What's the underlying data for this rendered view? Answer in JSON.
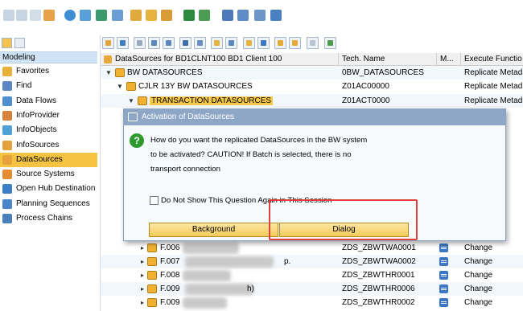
{
  "left_panel": {
    "header": "Modeling",
    "items": [
      {
        "label": "Favorites",
        "icon": "favorites-icon",
        "selected": false
      },
      {
        "label": "Find",
        "icon": "find-icon",
        "selected": false
      },
      {
        "label": "Data Flows",
        "icon": "data-flows-icon",
        "selected": false
      },
      {
        "label": "InfoProvider",
        "icon": "infoprovider-icon",
        "selected": false
      },
      {
        "label": "InfoObjects",
        "icon": "infoobjects-icon",
        "selected": false
      },
      {
        "label": "InfoSources",
        "icon": "infosources-icon",
        "selected": false
      },
      {
        "label": "DataSources",
        "icon": "datasources-icon",
        "selected": true
      },
      {
        "label": "Source Systems",
        "icon": "source-systems-icon",
        "selected": false
      },
      {
        "label": "Open Hub Destination",
        "icon": "open-hub-icon",
        "selected": false
      },
      {
        "label": "Planning Sequences",
        "icon": "planning-sequences-icon",
        "selected": false
      },
      {
        "label": "Process Chains",
        "icon": "process-chains-icon",
        "selected": false
      }
    ]
  },
  "table": {
    "columns": {
      "name": "DataSources for BD1CLNT100 BD1 Client 100",
      "tech": "Tech. Name",
      "m": "M...",
      "exec": "Execute Functio"
    },
    "rows": [
      {
        "name": "BW DATASOURCES",
        "tech": "0BW_DATASOURCES",
        "exec": "Replicate Metad"
      },
      {
        "name": "CJLR 13Y BW DATASOURCES",
        "tech": "Z01AC00000",
        "exec": "Replicate Metad"
      },
      {
        "name": "TRANSACTION DATASOURCES",
        "tech": "Z01ACT0000",
        "exec": "Replicate Metad"
      }
    ],
    "lower_rows": [
      {
        "name": "F.006",
        "tech": "ZDS_ZBWTWA0001",
        "exec": "Change"
      },
      {
        "name": "F.007",
        "suffix": "p.",
        "tech": "ZDS_ZBWTWA0002",
        "exec": "Change"
      },
      {
        "name": "F.008",
        "tech": "ZDS_ZBWTHR0001",
        "exec": "Change"
      },
      {
        "name": "F.009",
        "suffix": "h)",
        "tech": "ZDS_ZBWTHR0006",
        "exec": "Change"
      },
      {
        "name": "F.009",
        "tech": "ZDS_ZBWTHR0002",
        "exec": "Change"
      }
    ]
  },
  "dialog": {
    "title": "Activation of DataSources",
    "line1": "How do you want the replicated DataSources in the BW system",
    "line2": "to be activated? CAUTION! If Batch is selected, there is no",
    "line3": "transport connection",
    "checkbox_label": "Do Not Show This Question Again in This Session",
    "btn_background": "Background",
    "btn_dialog": "Dialog"
  },
  "colors": {
    "selection": "#f5c342",
    "header_blue": "#cfe3f5",
    "dialog_title": "#8fa7c7",
    "highlight_box": "#e0413a"
  }
}
